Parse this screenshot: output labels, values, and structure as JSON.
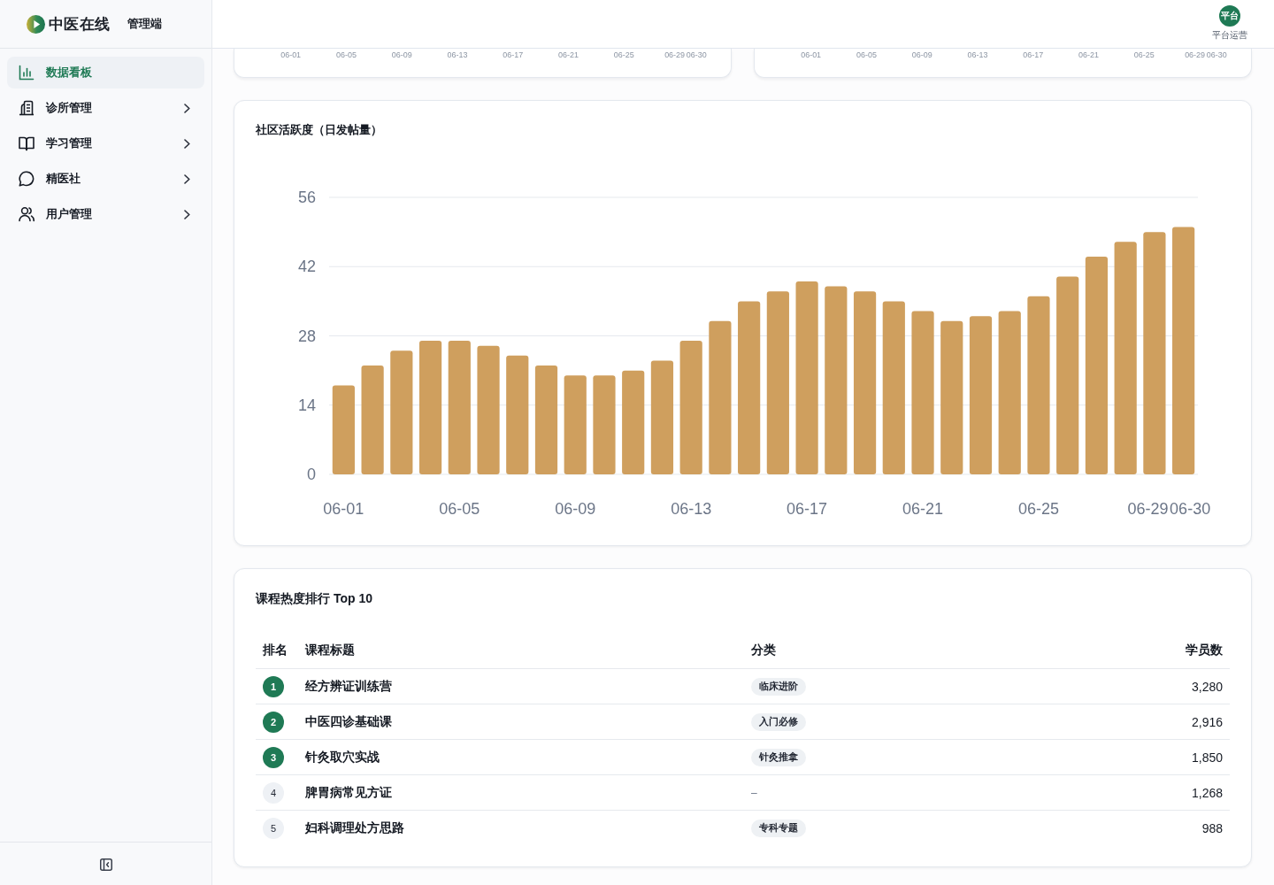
{
  "sidebar": {
    "brand": {
      "name": "中医在线",
      "subtitle": "管理端"
    },
    "items": [
      {
        "label": "数据看板",
        "selected": true,
        "has_submenu": false
      },
      {
        "label": "诊所管理",
        "selected": false,
        "has_submenu": true
      },
      {
        "label": "学习管理",
        "selected": false,
        "has_submenu": true
      },
      {
        "label": "精医社",
        "selected": false,
        "has_submenu": true
      },
      {
        "label": "用户管理",
        "selected": false,
        "has_submenu": true
      }
    ]
  },
  "header": {
    "user": {
      "avatar_text": "平台",
      "name": "平台运营"
    }
  },
  "top_charts": [
    {
      "x_labels": [
        "06-01",
        "06-05",
        "06-09",
        "06-13",
        "06-17",
        "06-21",
        "06-25",
        "06-29",
        "06-30"
      ]
    },
    {
      "x_labels": [
        "06-01",
        "06-05",
        "06-09",
        "06-13",
        "06-17",
        "06-21",
        "06-25",
        "06-29",
        "06-30"
      ]
    }
  ],
  "activity_card": {
    "title": "社区活跃度（日发帖量）",
    "chart_data": {
      "type": "bar",
      "categories": [
        "06-01",
        null,
        null,
        null,
        "06-05",
        null,
        null,
        null,
        "06-09",
        null,
        null,
        null,
        "06-13",
        null,
        null,
        null,
        "06-17",
        null,
        null,
        null,
        "06-21",
        null,
        null,
        null,
        "06-25",
        null,
        null,
        null,
        "06-29",
        "06-30"
      ],
      "values": [
        18,
        22,
        25,
        27,
        27,
        26,
        24,
        22,
        20,
        20,
        21,
        23,
        27,
        31,
        35,
        37,
        39,
        38,
        37,
        35,
        33,
        31,
        32,
        33,
        36,
        40,
        44,
        47,
        49,
        50
      ],
      "ylim": [
        0,
        56
      ],
      "yticks": [
        0,
        14,
        28,
        42,
        56
      ],
      "grid": true
    }
  },
  "ranking_card": {
    "title": "课程热度排行 Top 10",
    "columns": [
      "排名",
      "课程标题",
      "分类",
      "学员数"
    ],
    "rows": [
      {
        "rank": "1",
        "highlighted": true,
        "title": "经方辨证训练营",
        "category": {
          "kind": "tag",
          "text": "临床进阶"
        },
        "students": "3,280"
      },
      {
        "rank": "2",
        "highlighted": true,
        "title": "中医四诊基础课",
        "category": {
          "kind": "tag",
          "text": "入门必修"
        },
        "students": "2,916"
      },
      {
        "rank": "3",
        "highlighted": true,
        "title": "针灸取穴实战",
        "category": {
          "kind": "tag",
          "text": "针灸推拿"
        },
        "students": "1,850"
      },
      {
        "rank": "4",
        "highlighted": false,
        "title": "脾胃病常见方证",
        "category": {
          "kind": "plain",
          "text": "–"
        },
        "students": "1,268"
      },
      {
        "rank": "5",
        "highlighted": false,
        "title": "妇科调理处方思路",
        "category": {
          "kind": "tag",
          "text": "专科专题"
        },
        "students": "988"
      }
    ]
  }
}
